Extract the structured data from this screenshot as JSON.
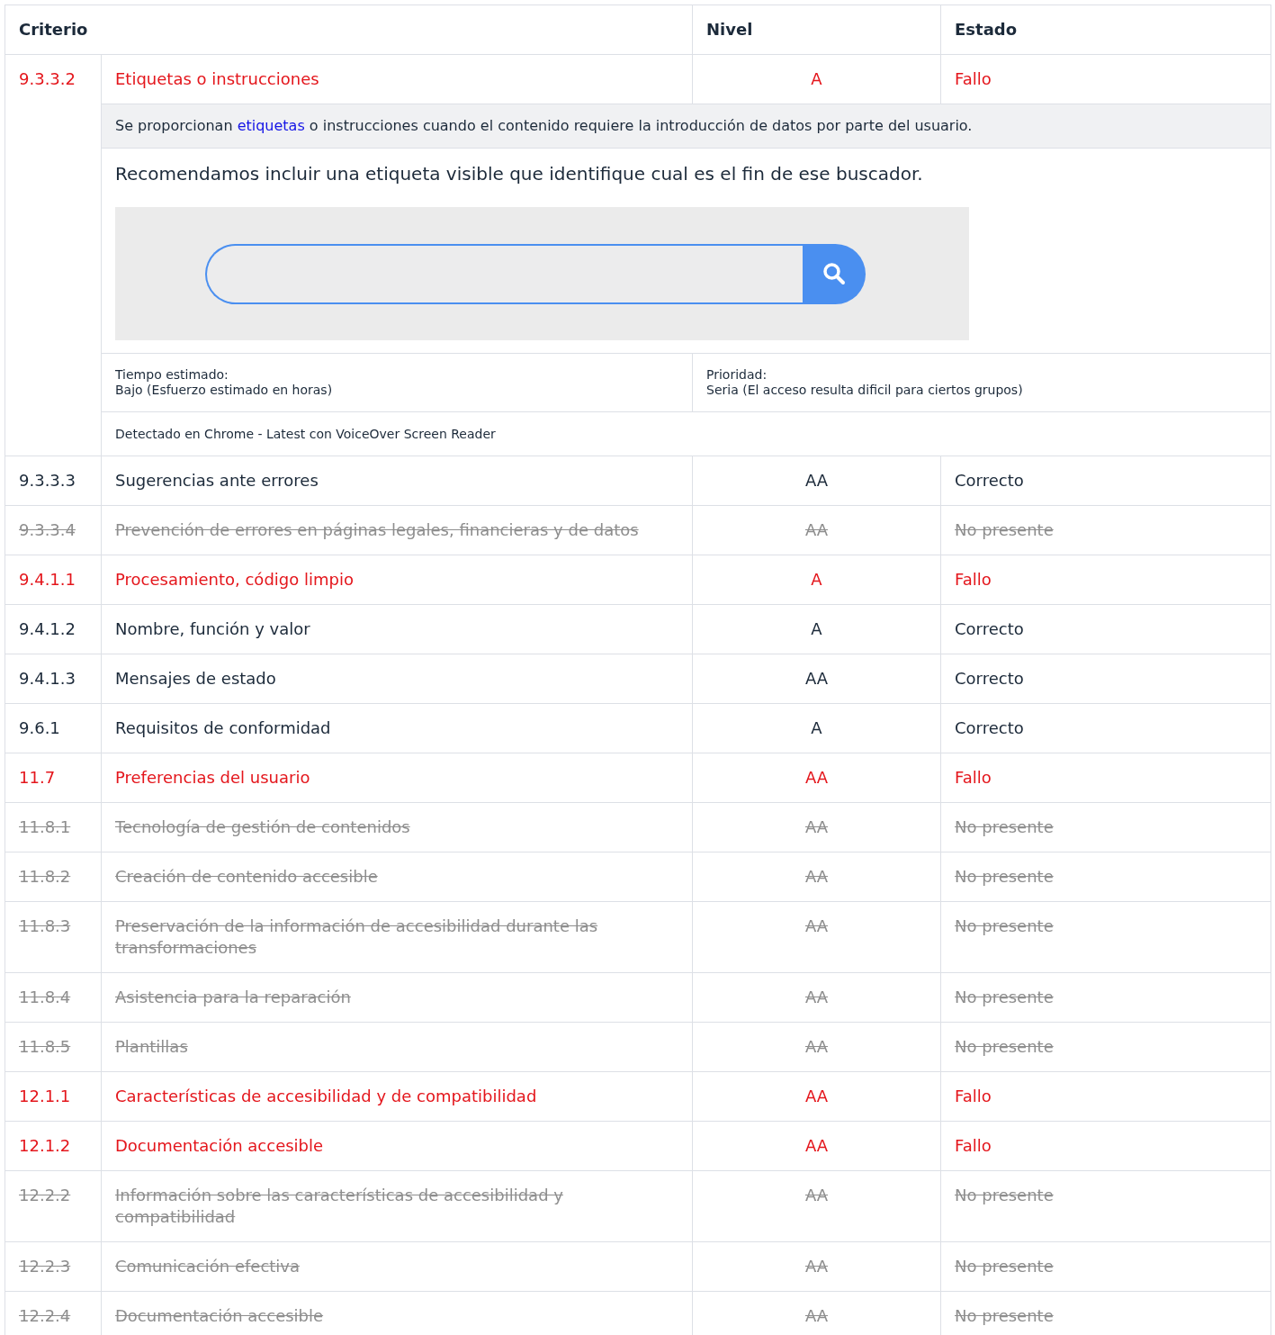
{
  "table": {
    "columns": [
      "Criterio",
      "Nivel",
      "Estado"
    ],
    "rows": [
      {
        "id": "9.3.3.2",
        "name": "Etiquetas o instrucciones",
        "level": "A",
        "status": "Fallo",
        "kind": "fail",
        "expanded": true,
        "detail": {
          "description": {
            "before": "Se proporcionan ",
            "link": "etiquetas",
            "after": " o instrucciones cuando el contenido requiere la introducción de datos por parte del usuario."
          },
          "recommendation": "Recomendamos incluir una etiqueta visible que identifique cual es el fin de ese buscador.",
          "time_label": "Tiempo estimado:",
          "time_value": "Bajo (Esfuerzo estimado en horas)",
          "priority_label": "Prioridad:",
          "priority_value": "Seria (El acceso resulta dificil para ciertos grupos)",
          "detected": "Detectado en Chrome - Latest con VoiceOver Screen Reader"
        }
      },
      {
        "id": "9.3.3.3",
        "name": "Sugerencias ante errores",
        "level": "AA",
        "status": "Correcto",
        "kind": "pass"
      },
      {
        "id": "9.3.3.4",
        "name": "Prevención de errores en páginas legales, financieras y de datos",
        "level": "AA",
        "status": "No presente",
        "kind": "absent"
      },
      {
        "id": "9.4.1.1",
        "name": "Procesamiento, código limpio",
        "level": "A",
        "status": "Fallo",
        "kind": "fail"
      },
      {
        "id": "9.4.1.2",
        "name": "Nombre, función y valor",
        "level": "A",
        "status": "Correcto",
        "kind": "pass"
      },
      {
        "id": "9.4.1.3",
        "name": "Mensajes de estado",
        "level": "AA",
        "status": "Correcto",
        "kind": "pass"
      },
      {
        "id": "9.6.1",
        "name": "Requisitos de conformidad",
        "level": "A",
        "status": "Correcto",
        "kind": "pass"
      },
      {
        "id": "11.7",
        "name": "Preferencias del usuario",
        "level": "AA",
        "status": "Fallo",
        "kind": "fail"
      },
      {
        "id": "11.8.1",
        "name": "Tecnología de gestión de contenidos",
        "level": "AA",
        "status": "No presente",
        "kind": "absent"
      },
      {
        "id": "11.8.2",
        "name": "Creación de contenido accesible",
        "level": "AA",
        "status": "No presente",
        "kind": "absent"
      },
      {
        "id": "11.8.3",
        "name": "Preservación de la información de accesibilidad durante las transformaciones",
        "level": "AA",
        "status": "No presente",
        "kind": "absent"
      },
      {
        "id": "11.8.4",
        "name": "Asistencia para la reparación",
        "level": "AA",
        "status": "No presente",
        "kind": "absent"
      },
      {
        "id": "11.8.5",
        "name": "Plantillas",
        "level": "AA",
        "status": "No presente",
        "kind": "absent"
      },
      {
        "id": "12.1.1",
        "name": "Características de accesibilidad y de compatibilidad",
        "level": "AA",
        "status": "Fallo",
        "kind": "fail"
      },
      {
        "id": "12.1.2",
        "name": "Documentación accesible",
        "level": "AA",
        "status": "Fallo",
        "kind": "fail"
      },
      {
        "id": "12.2.2",
        "name": "Información sobre las características de accesibilidad y compatibilidad",
        "level": "AA",
        "status": "No presente",
        "kind": "absent"
      },
      {
        "id": "12.2.3",
        "name": "Comunicación efectiva",
        "level": "AA",
        "status": "No presente",
        "kind": "absent"
      },
      {
        "id": "12.2.4",
        "name": "Documentación accesible",
        "level": "AA",
        "status": "No presente",
        "kind": "absent"
      }
    ]
  }
}
